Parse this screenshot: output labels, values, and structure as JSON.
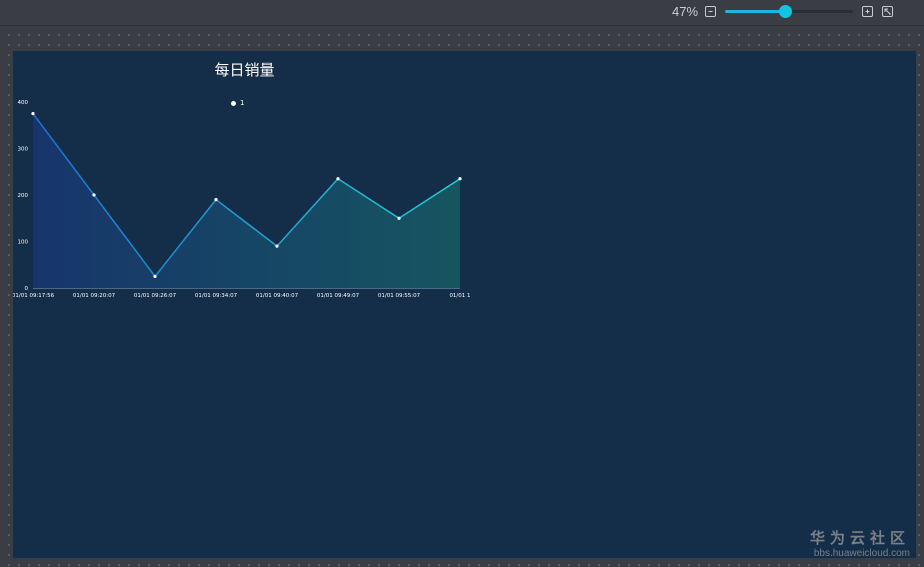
{
  "toolbar": {
    "zoom_label": "47%",
    "zoom_level": 0.47,
    "colors": {
      "slider_fill": "#20b2ea",
      "slider_knob": "#13c4e0"
    },
    "icons": [
      "zoom-out-icon",
      "zoom-in-icon",
      "fullscreen-icon"
    ]
  },
  "canvas": {
    "background": "#142d48"
  },
  "chart_data": {
    "type": "area",
    "title": "每日销量",
    "x_tick_labels": [
      "01/01 09:17:56",
      "01/01 09:20:07",
      "01/01 09:26:07",
      "01/01 09:34:07",
      "01/01 09:40:07",
      "01/01 09:49:07",
      "01/01 09:55:07",
      "01/01 1"
    ],
    "y_tick_labels": [
      "0",
      "100",
      "200",
      "300",
      "400"
    ],
    "ylim": [
      0,
      400
    ],
    "series": [
      {
        "name": "1",
        "values": [
          375,
          200,
          25,
          190,
          90,
          235,
          150,
          235
        ]
      }
    ],
    "colors": {
      "line_start": "#1f6fd0",
      "line_end": "#1ecfd6",
      "fill_start": "#17356b",
      "fill_end": "#165560"
    },
    "legend_position": "top-center",
    "grid": false
  },
  "watermark": {
    "name": "华为云社区",
    "url": "bbs.huaweicloud.com"
  }
}
